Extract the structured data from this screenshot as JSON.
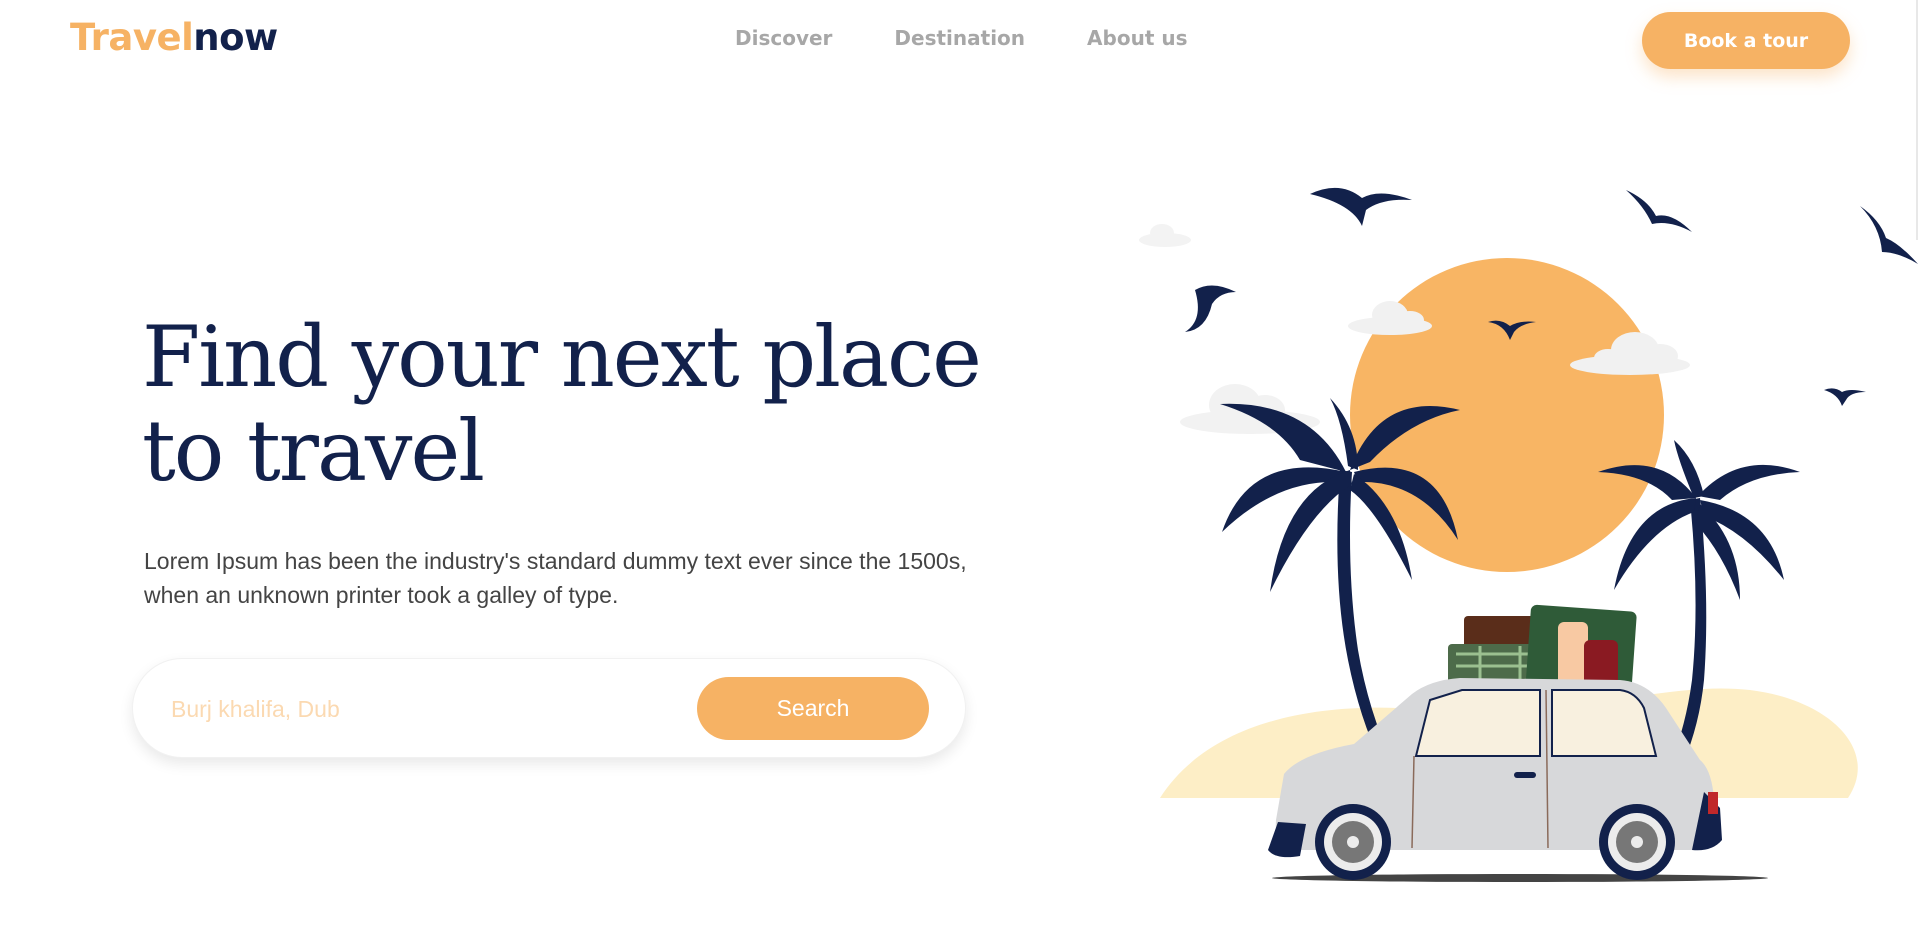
{
  "header": {
    "logo_part1": "Travel",
    "logo_part2": "now",
    "nav": [
      "Discover",
      "Destination",
      "About us"
    ],
    "cta_label": "Book a tour"
  },
  "hero": {
    "title_line1": "Find your next place",
    "title_line2": "to travel",
    "description": "Lorem Ipsum has been the industry's standard dummy text ever since the 1500s, when an unknown printer took a galley of type.",
    "search_placeholder": "Burj khalifa, Dub",
    "search_label": "Search"
  },
  "colors": {
    "accent": "#f6b264",
    "navy": "#12214b",
    "sand": "#fdeec6",
    "car": "#d7d8da"
  },
  "icons": [
    "bird-icon",
    "palm-tree-icon",
    "sun-icon",
    "cloud-icon",
    "car-icon",
    "luggage-icon"
  ]
}
